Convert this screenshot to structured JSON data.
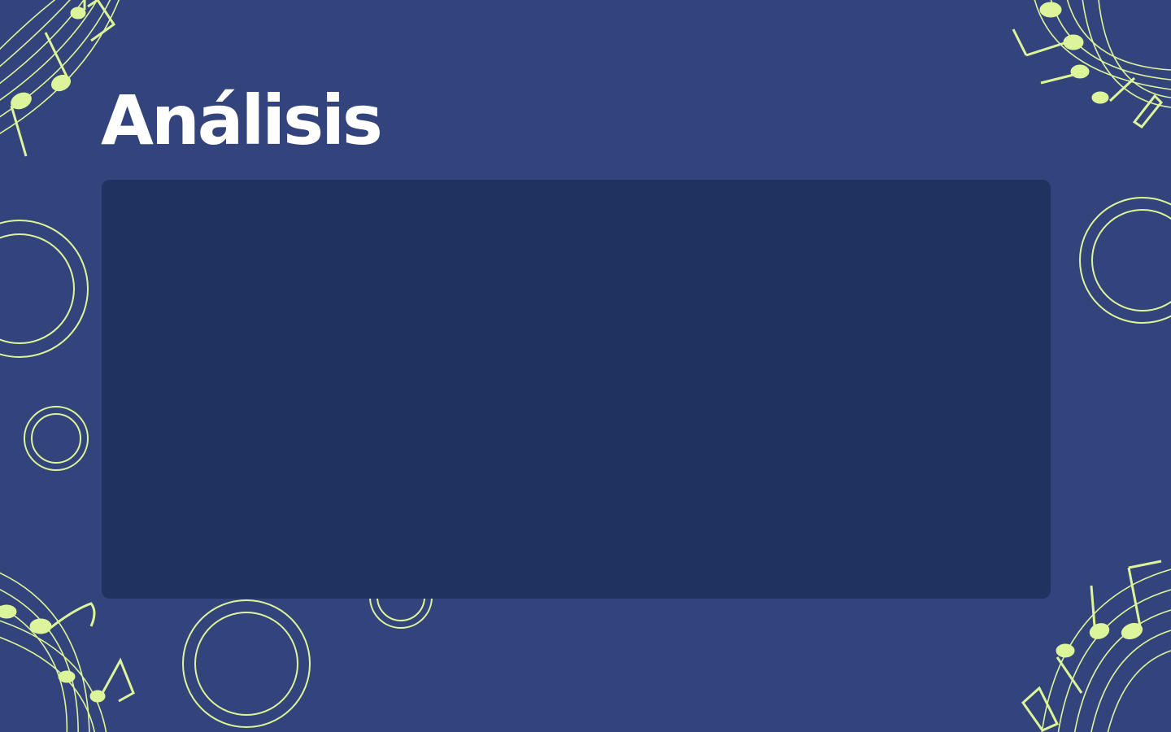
{
  "slide": {
    "title": "Análisis"
  },
  "colors": {
    "background": "#33437b",
    "panel": "#203260",
    "accent": "#dcf59a",
    "title_text": "#ffffff"
  },
  "decorations": {
    "icons": [
      "music-staff-icon",
      "music-note-icon",
      "ring-icon"
    ]
  }
}
